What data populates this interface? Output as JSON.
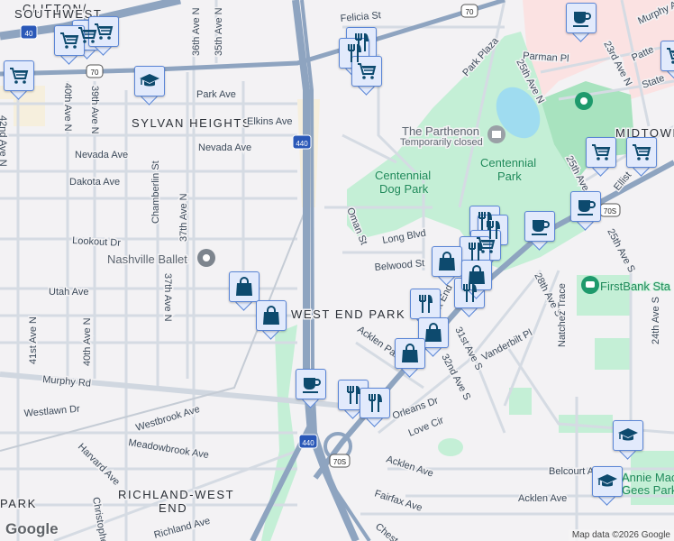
{
  "neighborhoods": [
    "CLIFTON/",
    "SOUTHWEST",
    "SYLVAN HEIGHTS",
    "MIDTOWN",
    "WEST END PARK",
    "RICHLAND-WEST",
    "END",
    "PARK"
  ],
  "streets": {
    "felicia": "Felicia St",
    "ave36": "36th Ave N",
    "ave35": "35th Ave N",
    "ave40": "40th Ave N",
    "ave39": "39th Ave N",
    "ave42": "42nd Ave N",
    "park_ave": "Park Ave",
    "elkins": "Elkins Ave",
    "nevada1": "Nevada Ave",
    "nevada2": "Nevada Ave",
    "dakota": "Dakota Ave",
    "chamberlin": "Chamberlin St",
    "ave37": "37th Ave N",
    "ave37b": "37th Ave N",
    "lookout": "Lookout Dr",
    "utah": "Utah Ave",
    "ave41": "41st Ave N",
    "ave40b": "40th Ave N",
    "murphy": "Murphy Rd",
    "westlawn": "Westlawn Dr",
    "westbrook": "Westbrook Ave",
    "meadowbrook": "Meadowbrook Ave",
    "harvard": "Harvard Ave",
    "christophe": "Christophe",
    "richland": "Richland Ave",
    "park_plaza": "Park Plaza",
    "parman": "Parman Pl",
    "ave25n": "25th Ave N",
    "ave25n2": "25th Ave N",
    "ave23n": "23rd Ave N",
    "murphy_ave": "Murphy Av",
    "patterson": "Patte",
    "state": "State",
    "elliston": "Ellist",
    "oman": "Oman St",
    "long_blvd": "Long Blvd",
    "belwood": "Belwood St",
    "ave25s": "25th Ave S",
    "ave28s": "28th Ave S",
    "natchez": "Natchez Trace",
    "vanderbilt": "Vanderbilt Pl",
    "ave31s": "31st Ave S",
    "ave32s": "32nd Ave S",
    "acklen_park": "Acklen Park",
    "orleans": "Orleans Dr",
    "love": "Love Cir",
    "acklen1": "Acklen Ave",
    "acklen2": "Acklen Ave",
    "fairfax": "Fairfax Ave",
    "belcourt": "Belcourt Av",
    "chest": "Chest",
    "westend": "West End",
    "ave24s": "24th Ave S"
  },
  "highways": {
    "i40": "40",
    "us70": "70",
    "i440a": "440",
    "i440b": "440",
    "us70s_a": "70S",
    "us70s_b": "70S"
  },
  "parks": {
    "centennial_dog_1": "Centennial",
    "centennial_dog_2": "Dog Park",
    "centennial_1": "Centennial",
    "centennial_2": "Park",
    "annie_1": "Annie Mac",
    "annie_2": "Gees Park"
  },
  "pois": {
    "parthenon": "The Parthenon",
    "parthenon_status": "Temporarily closed",
    "ballet": "Nashville Ballet",
    "firstbank": "FirstBank Sta"
  },
  "markers": [
    "cart",
    "cart",
    "cart",
    "cart",
    "school",
    "food",
    "food",
    "cart",
    "coffee",
    "cart",
    "cart",
    "cart",
    "coffee",
    "coffee",
    "food",
    "food",
    "cart",
    "food",
    "bag",
    "bag",
    "food",
    "food",
    "bag",
    "bag",
    "bag",
    "bag",
    "coffee",
    "food",
    "food",
    "school",
    "school"
  ],
  "colors": {
    "marker_icon": "#0d4a6e",
    "marker_bg": "#e2eafc",
    "marker_border": "#5b86d6",
    "highway": "#8ea4c0",
    "park": "#c4efd6",
    "medical": "#fbe2e2"
  },
  "footer": {
    "logo": "Google",
    "attribution": "Map data ©2026 Google"
  }
}
